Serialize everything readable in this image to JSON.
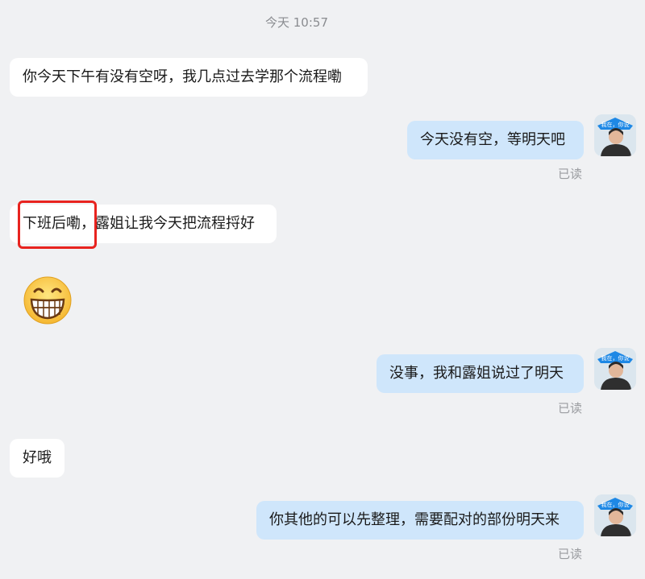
{
  "timestamp": "今天 10:57",
  "messages": [
    {
      "side": "left",
      "text": "你今天下午有没有空呀，我几点过去学那个流程嘞"
    },
    {
      "side": "right",
      "text": "今天没有空，等明天吧",
      "status": "已读"
    },
    {
      "side": "left",
      "text": "下班后嘞，露姐让我今天把流程捋好",
      "highlighted_phrase": "下班后嘞"
    },
    {
      "side": "left",
      "type": "emoji",
      "emoji": "grinning-face-emoji"
    },
    {
      "side": "right",
      "text": "没事，我和露姐说过了明天",
      "status": "已读"
    },
    {
      "side": "left",
      "text": "好哦"
    },
    {
      "side": "right",
      "text": "你其他的可以先整理，需要配对的部份明天来",
      "status": "已读"
    }
  ],
  "avatar": {
    "badge_text": "我在，你说",
    "accent_color": "#1e88e5"
  },
  "colors": {
    "background": "#f0f1f3",
    "left_bubble": "#ffffff",
    "right_bubble": "#cfe6fb",
    "highlight_box": "#e8231f"
  }
}
